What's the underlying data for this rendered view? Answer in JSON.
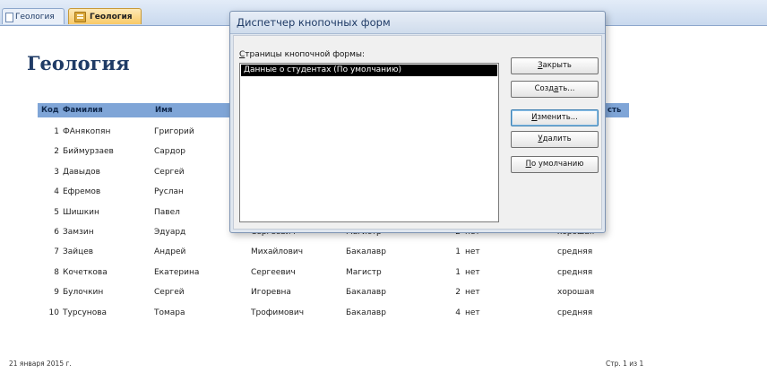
{
  "tabs": [
    {
      "label": "Геология",
      "active": false
    },
    {
      "label": "Геология",
      "active": true
    }
  ],
  "report": {
    "title": "Геология",
    "columns": [
      "Код",
      "Фамилия",
      "Имя",
      "сть"
    ],
    "rows": [
      {
        "id": "1",
        "surname": "ФАнякопян",
        "name": "Григорий",
        "patronymic": "",
        "degree": "",
        "course": "",
        "flag": "",
        "quality": ""
      },
      {
        "id": "2",
        "surname": "Биймурзаев",
        "name": "Сардор",
        "patronymic": "",
        "degree": "",
        "course": "",
        "flag": "",
        "quality": ""
      },
      {
        "id": "3",
        "surname": "Давыдов",
        "name": "Сергей",
        "patronymic": "",
        "degree": "",
        "course": "",
        "flag": "",
        "quality": ""
      },
      {
        "id": "4",
        "surname": "Ефремов",
        "name": "Руслан",
        "patronymic": "",
        "degree": "",
        "course": "",
        "flag": "",
        "quality": ""
      },
      {
        "id": "5",
        "surname": "Шишкин",
        "name": "Павел",
        "patronymic": "",
        "degree": "",
        "course": "",
        "flag": "",
        "quality": ""
      },
      {
        "id": "6",
        "surname": "Замзин",
        "name": "Эдуард",
        "patronymic": "Сергеевич",
        "degree": "Магистр",
        "course": "2",
        "flag": "нет",
        "quality": "хорошая"
      },
      {
        "id": "7",
        "surname": "Зайцев",
        "name": "Андрей",
        "patronymic": "Михайлович",
        "degree": "Бакалавр",
        "course": "1",
        "flag": "нет",
        "quality": "средняя"
      },
      {
        "id": "8",
        "surname": "Кочеткова",
        "name": "Екатерина",
        "patronymic": "Сергеевич",
        "degree": "Магистр",
        "course": "1",
        "flag": "нет",
        "quality": "средняя"
      },
      {
        "id": "9",
        "surname": "Булочкин",
        "name": "Сергей",
        "patronymic": "Игоревна",
        "degree": "Бакалавр",
        "course": "2",
        "flag": "нет",
        "quality": "хорошая"
      },
      {
        "id": "10",
        "surname": "Турсунова",
        "name": "Томара",
        "patronymic": "Трофимович",
        "degree": "Бакалавр",
        "course": "4",
        "flag": "нет",
        "quality": "средняя"
      }
    ],
    "footer_date": "21 января 2015 г.",
    "footer_page": "Стр. 1 из 1"
  },
  "dialog": {
    "title": "Диспетчер кнопочных форм",
    "list_label_mnemonic": "С",
    "list_label_rest": "траницы кнопочной формы:",
    "list_items": [
      "Данные о студентах (По умолчанию)"
    ],
    "buttons": {
      "close": {
        "mnemonic": "З",
        "rest": "акрыть"
      },
      "create_pre": "Созд",
      "create_mnemonic": "а",
      "create_post": "ть...",
      "edit": {
        "mnemonic": "И",
        "rest": "зменить..."
      },
      "delete": {
        "mnemonic": "У",
        "rest": "далить"
      },
      "default": {
        "mnemonic": "П",
        "rest": "о умолчанию"
      }
    }
  },
  "colors": {
    "accent": "#1f3b66",
    "header_bar": "#7fa5d7",
    "active_tab": "#f9c967",
    "selection": "#000000"
  },
  "icons": [
    "document-icon",
    "form-icon"
  ]
}
